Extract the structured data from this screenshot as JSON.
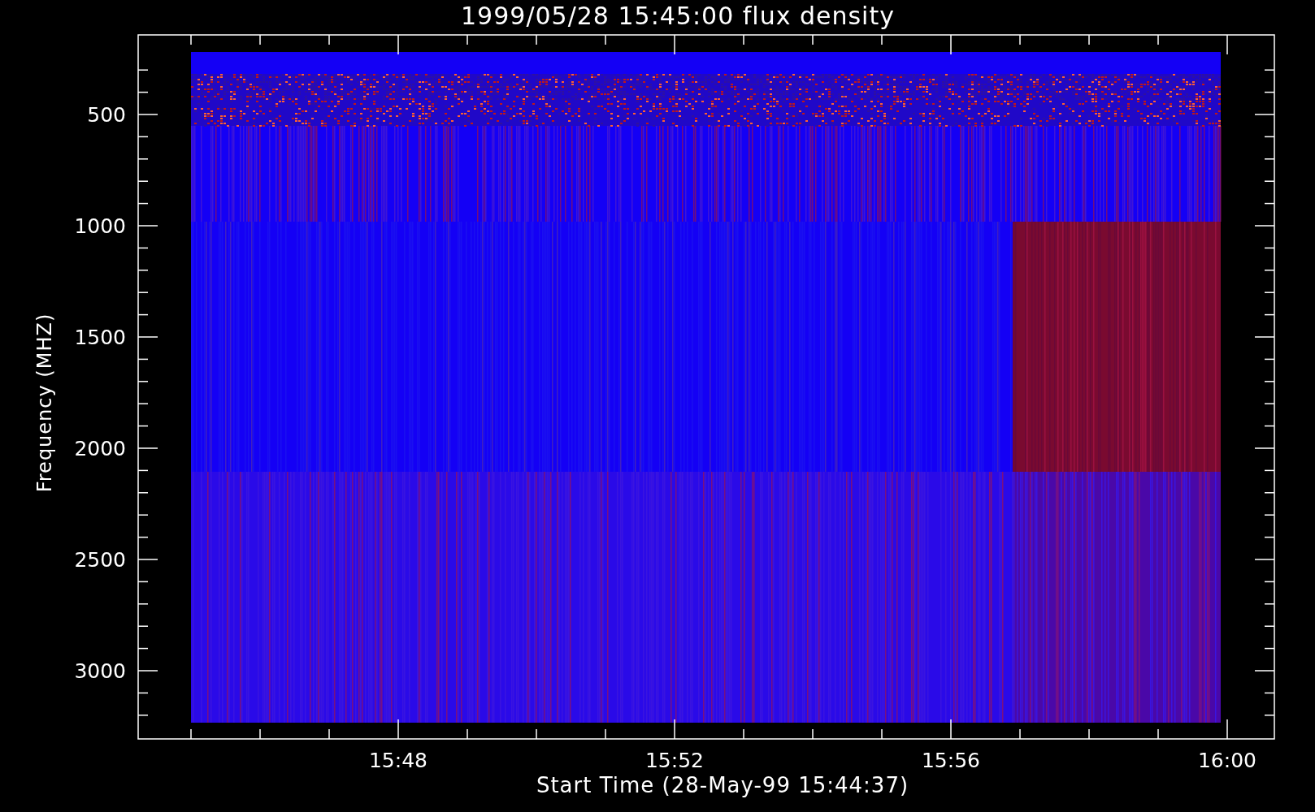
{
  "plot": {
    "title": "1999/05/28 15:45:00 flux density",
    "xlabel": "Start Time (28-May-99 15:44:37)",
    "ylabel": "Frequency (MHZ)",
    "xticks": [
      "15:48",
      "15:52",
      "15:56",
      "16:00"
    ],
    "yticks": [
      "500",
      "1000",
      "1500",
      "2000",
      "2500",
      "3000"
    ]
  }
}
